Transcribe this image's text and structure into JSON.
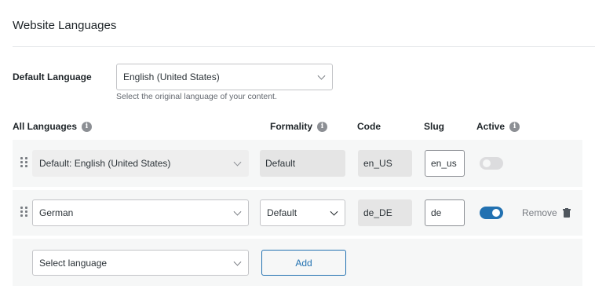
{
  "page_title": "Website Languages",
  "default_language": {
    "label": "Default Language",
    "value": "English (United States)",
    "help_text": "Select the original language of your content."
  },
  "table_headers": {
    "all_languages": "All Languages",
    "formality": "Formality",
    "code": "Code",
    "slug": "Slug",
    "active": "Active"
  },
  "rows": [
    {
      "language": "Default: English (United States)",
      "formality": "Default",
      "code": "en_US",
      "slug": "en_us",
      "active": true,
      "active_editable": false
    },
    {
      "language": "German",
      "formality": "Default",
      "code": "de_DE",
      "slug": "de",
      "active": true,
      "active_editable": true,
      "remove_label": "Remove"
    }
  ],
  "add_row": {
    "select_placeholder": "Select language",
    "add_label": "Add"
  },
  "colors": {
    "accent": "#2271b1",
    "row_background": "#f6f7f7",
    "readonly_background": "#e5e5e5"
  },
  "icons": [
    "info-icon",
    "drag-handle-icon",
    "chevron-down-icon",
    "trash-icon"
  ]
}
